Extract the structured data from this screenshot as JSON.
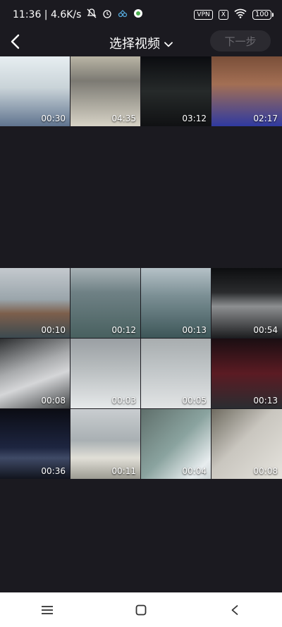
{
  "status": {
    "time_speed": "11:36 | 4.6K/s",
    "vpn": "VPN",
    "x_badge": "X",
    "battery": "100"
  },
  "header": {
    "title": "选择视频",
    "next_label": "下一步"
  },
  "top_grid": [
    {
      "duration": "00:30"
    },
    {
      "duration": "04:35"
    },
    {
      "duration": "03:12"
    },
    {
      "duration": "02:17"
    }
  ],
  "bottom_grid": [
    {
      "duration": "00:10"
    },
    {
      "duration": "00:12"
    },
    {
      "duration": "00:13"
    },
    {
      "duration": "00:54"
    },
    {
      "duration": "00:08"
    },
    {
      "duration": "00:03"
    },
    {
      "duration": "00:05"
    },
    {
      "duration": "00:13"
    },
    {
      "duration": "00:36"
    },
    {
      "duration": "00:11"
    },
    {
      "duration": "00:04"
    },
    {
      "duration": "00:08"
    }
  ],
  "colors": {
    "background": "#1b1a20",
    "next_button_bg": "#2b2a30",
    "next_button_text": "#6b6a70",
    "nav_bar_bg": "#ffffff"
  },
  "icons": {
    "back": "chevron-left-icon",
    "title_dropdown": "chevron-down-icon",
    "nav_menu": "menu-icon",
    "nav_home": "home-square-icon",
    "nav_back": "back-triangle-icon"
  }
}
